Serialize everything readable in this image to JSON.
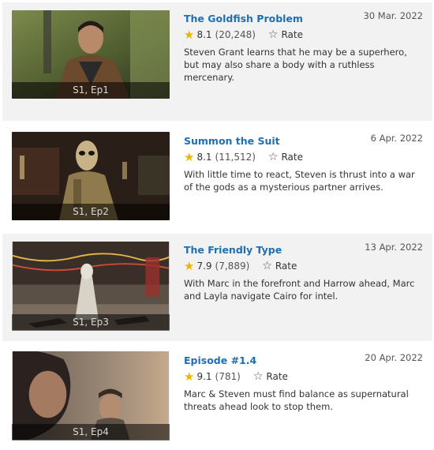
{
  "episodes": [
    {
      "title": "The Goldfish Problem",
      "airdate": "30 Mar. 2022",
      "rating": "8.1",
      "votes": "(20,248)",
      "rate_label": "Rate",
      "description": "Steven Grant learns that he may be a superhero, but may also share a body with a ruthless mercenary.",
      "episode_label": "S1, Ep1"
    },
    {
      "title": "Summon the Suit",
      "airdate": "6 Apr. 2022",
      "rating": "8.1",
      "votes": "(11,512)",
      "rate_label": "Rate",
      "description": "With little time to react, Steven is thrust into a war of the gods as a mysterious partner arrives.",
      "episode_label": "S1, Ep2"
    },
    {
      "title": "The Friendly Type",
      "airdate": "13 Apr. 2022",
      "rating": "7.9",
      "votes": "(7,889)",
      "rate_label": "Rate",
      "description": "With Marc in the forefront and Harrow ahead, Marc and Layla navigate Cairo for intel.",
      "episode_label": "S1, Ep3"
    },
    {
      "title": "Episode #1.4",
      "airdate": "20 Apr. 2022",
      "rating": "9.1",
      "votes": "(781)",
      "rate_label": "Rate",
      "description": "Marc & Steven must find balance as supernatural threats ahead look to stop them.",
      "episode_label": "S1, Ep4"
    }
  ],
  "icons": {
    "rating": "star-filled-icon",
    "rate": "star-outline-icon"
  },
  "colors": {
    "title_link": "#1f6fb2",
    "star": "#f0b400",
    "alt_row": "#f2f2f2"
  }
}
